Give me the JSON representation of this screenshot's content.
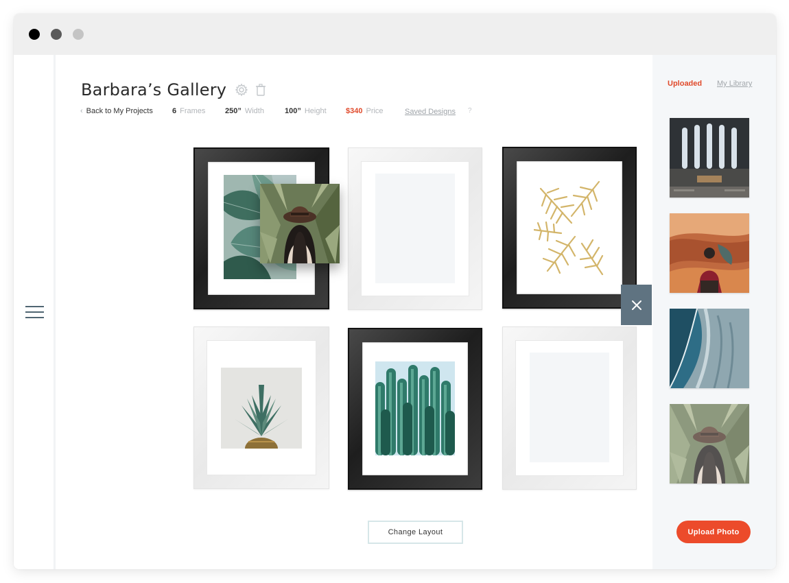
{
  "window": {
    "controls": [
      "close",
      "minimize",
      "maximize"
    ]
  },
  "sidebar": {
    "menu_icon": "hamburger-menu-icon"
  },
  "header": {
    "title": "Barbara’s Gallery",
    "settings_icon": "gear-icon",
    "delete_icon": "trash-icon"
  },
  "meta": {
    "back_label": "Back to My Projects",
    "frames_value": "6",
    "frames_label": "Frames",
    "width_value": "250”",
    "width_label": "Width",
    "height_value": "100”",
    "height_label": "Height",
    "price_value": "$340",
    "price_label": "Price",
    "saved_designs": "Saved Designs",
    "help": "?"
  },
  "gallery": {
    "frames": [
      {
        "id": 1,
        "style": "black",
        "art": "tropical leaves"
      },
      {
        "id": 2,
        "style": "white",
        "art": "empty"
      },
      {
        "id": 3,
        "style": "black",
        "art": "gold palm leaves"
      },
      {
        "id": 4,
        "style": "white",
        "art": "pineapple"
      },
      {
        "id": 5,
        "style": "black",
        "art": "cactus"
      },
      {
        "id": 6,
        "style": "white",
        "art": "empty"
      }
    ],
    "dragging_photo": "woman in hat",
    "remove_icon": "close-icon",
    "change_layout_label": "Change Layout"
  },
  "library": {
    "tab_uploaded": "Uploaded",
    "tab_library": "My Library",
    "photos": [
      "cathedral interior",
      "canyon overlook",
      "aerial beach",
      "woman in hat"
    ],
    "upload_label": "Upload Photo"
  },
  "colors": {
    "accent": "#ec4b2b",
    "price": "#e04a2b",
    "close_button": "#5f7381",
    "sidebar_bg": "#f5f7f9"
  }
}
